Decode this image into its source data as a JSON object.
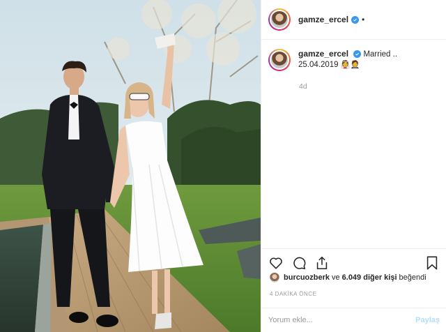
{
  "header": {
    "username": "gamze_ercel",
    "verified": true,
    "more_dot": "•"
  },
  "caption": {
    "username": "gamze_ercel",
    "text": "Married ..",
    "date": "25.04.2019",
    "emojis": "👰🤵"
  },
  "post_age": "4d",
  "actions": {
    "like_icon": "heart-icon",
    "comment_icon": "comment-icon",
    "share_icon": "share-icon",
    "save_icon": "bookmark-icon"
  },
  "likes": {
    "user": "burcuozberk",
    "joiner": "ve",
    "others": "6.049 diğer kişi",
    "suffix": "beğendi"
  },
  "timestamp": "4 DAKİKA ÖNCE",
  "comment": {
    "placeholder": "Yorum ekle...",
    "post_label": "Paylaş"
  },
  "colors": {
    "verified_blue": "#3897f0",
    "post_button": "#b2dffc",
    "muted_text": "#999999",
    "border": "#efefef"
  }
}
